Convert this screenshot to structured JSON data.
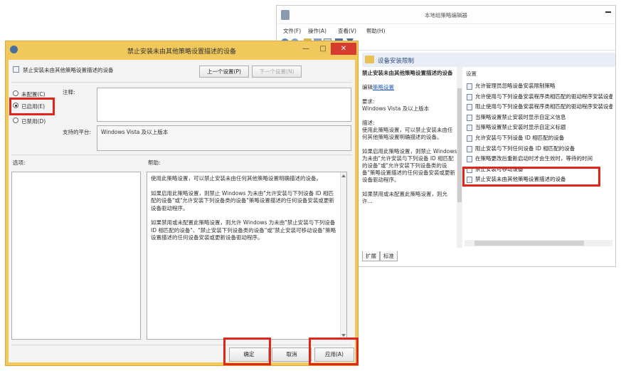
{
  "editor": {
    "title": "本地组策略编辑器",
    "menu": [
      "文件(F)",
      "操作(A)",
      "查看(V)",
      "帮助(H)"
    ],
    "header": "设备安装限制",
    "description": {
      "policy_name": "禁止安装未由其他策略设置描述的设备",
      "edit_prefix": "编辑",
      "edit_link": "策略设置",
      "requirements_label": "要求:",
      "requirements_value": "Windows Vista 及以上版本",
      "desc_label": "描述:",
      "desc_text": "使用此策略设置，可以禁止安装未由任何其他策略设置明确描述的设备。",
      "desc_more": "如果启用此策略设置，则禁止 Windows 为未由\"允许安装与下列设备 ID 相匹配的设备\"或\"允许安装下列设备类的设备\"策略设置描述的任何设备安装或更新设备驱动程序。",
      "desc_more2": "如果禁用或未配置此策略设置，则允许..."
    },
    "settings_header": "设置",
    "settings": [
      "允许管理员忽略设备安装限制策略",
      "允许使用与下列设备安装程序类相匹配的驱动程序安装设备",
      "阻止使用与下列设备安装程序类相匹配的驱动程序安装设备",
      "当策略设置禁止安装时显示自定义信息",
      "当策略设置禁止安装时显示自定义标题",
      "允许安装与下列设备 ID 相匹配的设备",
      "阻止安装与下列任何设备 ID 相匹配的设备",
      "在策略更改后重新启动时才会生效时，等待的时间",
      "禁止安装可移动设备",
      "禁止安装未由其他策略设置描述的设备"
    ],
    "tabs": [
      "扩展",
      "标准"
    ]
  },
  "dialog": {
    "title": "禁止安装未由其他策略设置描述的设备",
    "policy_name": "禁止安装未由其他策略设置描述的设备",
    "prev_button": "上一个设置(P)",
    "next_button": "下一个设置(N)",
    "radio": {
      "not_configured": "未配置(C)",
      "enabled": "已启用(E)",
      "disabled": "已禁用(D)",
      "selected": "enabled"
    },
    "comment_label": "注释:",
    "supported_label": "支持的平台:",
    "supported_value": "Windows Vista 及以上版本",
    "options_label": "选项:",
    "help_label": "帮助:",
    "help_paragraphs": [
      "使用此策略设置，可以禁止安装未由任何其他策略设置明确描述的设备。",
      "如果启用此策略设置，则禁止 Windows 为未由\"允许安装与下列设备 ID 相匹配的设备\"或\"允许安装下列设备类的设备\"策略设置描述的任何设备安装或更新设备驱动程序。",
      "如果禁用或未配置此策略设置，则允许 Windows 为未由\"禁止安装与下列设备 ID 相匹配的设备\"、\"禁止安装下列设备类的设备\"或\"禁止安装可移动设备\"策略设置描述的任何设备安装或更新设备驱动程序。"
    ],
    "ok_button": "确定",
    "cancel_button": "取消",
    "apply_button": "应用(A)",
    "minimize_glyph": "—",
    "maximize_glyph": "□",
    "close_glyph": "✕"
  },
  "colors": {
    "highlight": "#e0261b",
    "dialog_frame": "#f0c85c",
    "close_button": "#d63b30"
  }
}
